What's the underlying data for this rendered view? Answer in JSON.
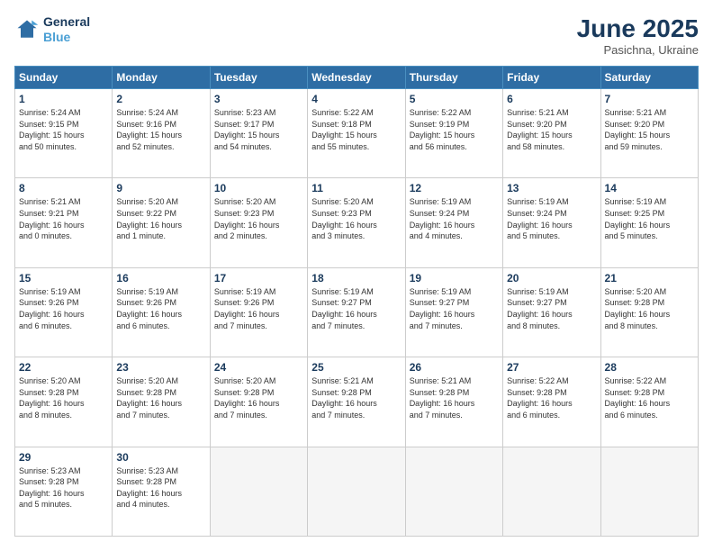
{
  "logo": {
    "line1": "General",
    "line2": "Blue"
  },
  "title": "June 2025",
  "location": "Pasichna, Ukraine",
  "days_header": [
    "Sunday",
    "Monday",
    "Tuesday",
    "Wednesday",
    "Thursday",
    "Friday",
    "Saturday"
  ],
  "weeks": [
    [
      {
        "num": "1",
        "info": "Sunrise: 5:24 AM\nSunset: 9:15 PM\nDaylight: 15 hours\nand 50 minutes."
      },
      {
        "num": "2",
        "info": "Sunrise: 5:24 AM\nSunset: 9:16 PM\nDaylight: 15 hours\nand 52 minutes."
      },
      {
        "num": "3",
        "info": "Sunrise: 5:23 AM\nSunset: 9:17 PM\nDaylight: 15 hours\nand 54 minutes."
      },
      {
        "num": "4",
        "info": "Sunrise: 5:22 AM\nSunset: 9:18 PM\nDaylight: 15 hours\nand 55 minutes."
      },
      {
        "num": "5",
        "info": "Sunrise: 5:22 AM\nSunset: 9:19 PM\nDaylight: 15 hours\nand 56 minutes."
      },
      {
        "num": "6",
        "info": "Sunrise: 5:21 AM\nSunset: 9:20 PM\nDaylight: 15 hours\nand 58 minutes."
      },
      {
        "num": "7",
        "info": "Sunrise: 5:21 AM\nSunset: 9:20 PM\nDaylight: 15 hours\nand 59 minutes."
      }
    ],
    [
      {
        "num": "8",
        "info": "Sunrise: 5:21 AM\nSunset: 9:21 PM\nDaylight: 16 hours\nand 0 minutes."
      },
      {
        "num": "9",
        "info": "Sunrise: 5:20 AM\nSunset: 9:22 PM\nDaylight: 16 hours\nand 1 minute."
      },
      {
        "num": "10",
        "info": "Sunrise: 5:20 AM\nSunset: 9:23 PM\nDaylight: 16 hours\nand 2 minutes."
      },
      {
        "num": "11",
        "info": "Sunrise: 5:20 AM\nSunset: 9:23 PM\nDaylight: 16 hours\nand 3 minutes."
      },
      {
        "num": "12",
        "info": "Sunrise: 5:19 AM\nSunset: 9:24 PM\nDaylight: 16 hours\nand 4 minutes."
      },
      {
        "num": "13",
        "info": "Sunrise: 5:19 AM\nSunset: 9:24 PM\nDaylight: 16 hours\nand 5 minutes."
      },
      {
        "num": "14",
        "info": "Sunrise: 5:19 AM\nSunset: 9:25 PM\nDaylight: 16 hours\nand 5 minutes."
      }
    ],
    [
      {
        "num": "15",
        "info": "Sunrise: 5:19 AM\nSunset: 9:26 PM\nDaylight: 16 hours\nand 6 minutes."
      },
      {
        "num": "16",
        "info": "Sunrise: 5:19 AM\nSunset: 9:26 PM\nDaylight: 16 hours\nand 6 minutes."
      },
      {
        "num": "17",
        "info": "Sunrise: 5:19 AM\nSunset: 9:26 PM\nDaylight: 16 hours\nand 7 minutes."
      },
      {
        "num": "18",
        "info": "Sunrise: 5:19 AM\nSunset: 9:27 PM\nDaylight: 16 hours\nand 7 minutes."
      },
      {
        "num": "19",
        "info": "Sunrise: 5:19 AM\nSunset: 9:27 PM\nDaylight: 16 hours\nand 7 minutes."
      },
      {
        "num": "20",
        "info": "Sunrise: 5:19 AM\nSunset: 9:27 PM\nDaylight: 16 hours\nand 8 minutes."
      },
      {
        "num": "21",
        "info": "Sunrise: 5:20 AM\nSunset: 9:28 PM\nDaylight: 16 hours\nand 8 minutes."
      }
    ],
    [
      {
        "num": "22",
        "info": "Sunrise: 5:20 AM\nSunset: 9:28 PM\nDaylight: 16 hours\nand 8 minutes."
      },
      {
        "num": "23",
        "info": "Sunrise: 5:20 AM\nSunset: 9:28 PM\nDaylight: 16 hours\nand 7 minutes."
      },
      {
        "num": "24",
        "info": "Sunrise: 5:20 AM\nSunset: 9:28 PM\nDaylight: 16 hours\nand 7 minutes."
      },
      {
        "num": "25",
        "info": "Sunrise: 5:21 AM\nSunset: 9:28 PM\nDaylight: 16 hours\nand 7 minutes."
      },
      {
        "num": "26",
        "info": "Sunrise: 5:21 AM\nSunset: 9:28 PM\nDaylight: 16 hours\nand 7 minutes."
      },
      {
        "num": "27",
        "info": "Sunrise: 5:22 AM\nSunset: 9:28 PM\nDaylight: 16 hours\nand 6 minutes."
      },
      {
        "num": "28",
        "info": "Sunrise: 5:22 AM\nSunset: 9:28 PM\nDaylight: 16 hours\nand 6 minutes."
      }
    ],
    [
      {
        "num": "29",
        "info": "Sunrise: 5:23 AM\nSunset: 9:28 PM\nDaylight: 16 hours\nand 5 minutes."
      },
      {
        "num": "30",
        "info": "Sunrise: 5:23 AM\nSunset: 9:28 PM\nDaylight: 16 hours\nand 4 minutes."
      },
      {
        "num": "",
        "info": ""
      },
      {
        "num": "",
        "info": ""
      },
      {
        "num": "",
        "info": ""
      },
      {
        "num": "",
        "info": ""
      },
      {
        "num": "",
        "info": ""
      }
    ]
  ]
}
